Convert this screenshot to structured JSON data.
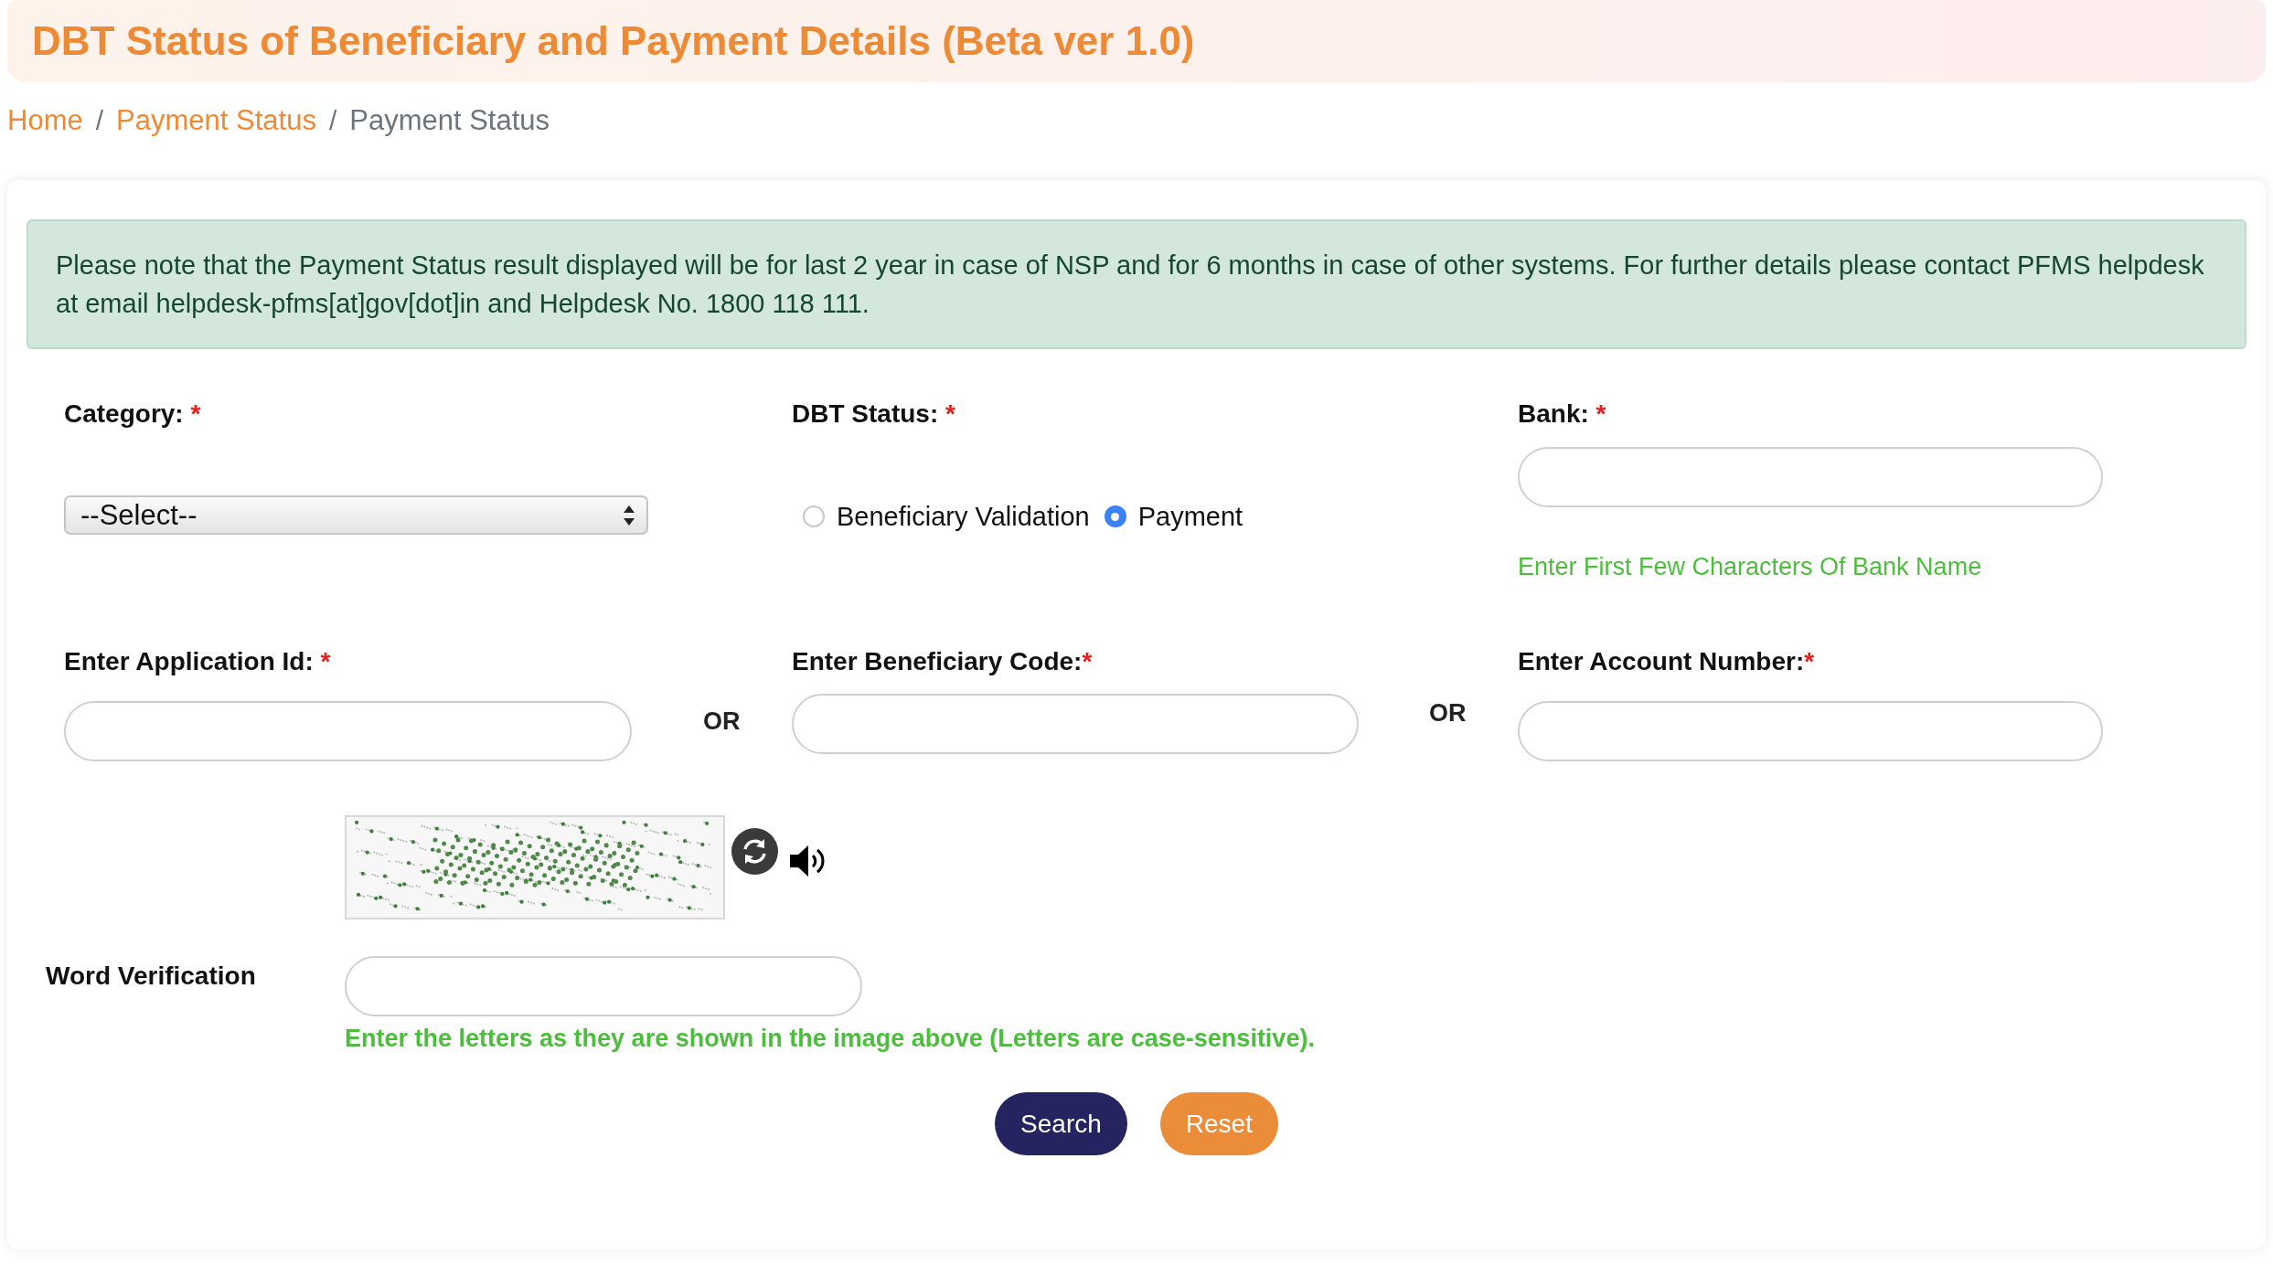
{
  "header": {
    "title": "DBT Status of Beneficiary and Payment Details (Beta ver 1.0)"
  },
  "breadcrumb": {
    "items": [
      {
        "label": "Home",
        "kind": "link"
      },
      {
        "label": "Payment Status",
        "kind": "link"
      },
      {
        "label": "Payment Status",
        "kind": "current"
      }
    ],
    "separators": [
      "/",
      "/"
    ]
  },
  "notice": {
    "text": "Please note that the Payment Status result displayed will be for last 2 year in case of NSP and for 6 months in case of other systems. For further details please contact PFMS helpdesk at email helpdesk-pfms[at]gov[dot]in and Helpdesk No. 1800 118 111."
  },
  "category": {
    "label": "Category:",
    "required_mark": " *",
    "value": "--Select--"
  },
  "dbt_status": {
    "label": "DBT Status:",
    "required_mark": " *",
    "options": [
      {
        "label": "Beneficiary Validation",
        "selected": false
      },
      {
        "label": "Payment",
        "selected": true
      }
    ]
  },
  "bank": {
    "label": "Bank:",
    "required_mark": " *",
    "hint": "Enter First Few Characters Of Bank Name"
  },
  "id_fields": [
    {
      "label": "Enter Application Id:",
      "required_mark": " *"
    },
    {
      "label": "Enter Beneficiary Code:",
      "required_mark": "*"
    },
    {
      "label": "Enter Account Number:",
      "required_mark": "*"
    }
  ],
  "separators": [
    "OR",
    "OR"
  ],
  "verification": {
    "label": "Word Verification",
    "hint": "Enter the letters as they are shown in the image above (Letters are case-sensitive)."
  },
  "buttons": [
    {
      "label": "Search",
      "kind": "primary"
    },
    {
      "label": "Reset",
      "kind": "secondary"
    }
  ]
}
